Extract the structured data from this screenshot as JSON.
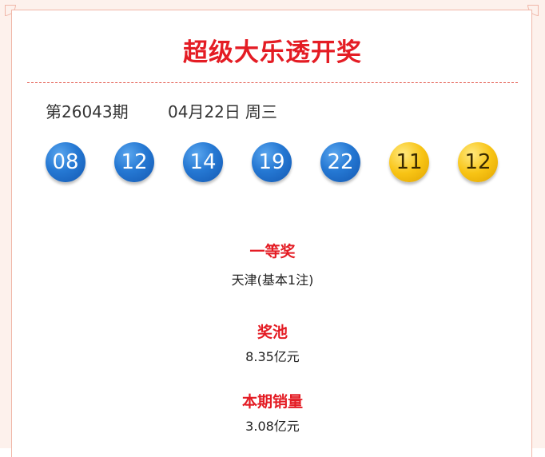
{
  "title": "超级大乐透开奖",
  "draw": {
    "issue": "第26043期",
    "date": "04月22日",
    "weekday": "周三"
  },
  "numbers": {
    "front": [
      "08",
      "12",
      "14",
      "19",
      "22"
    ],
    "back": [
      "11",
      "12"
    ]
  },
  "prizes": {
    "first_prize_label": "一等奖",
    "first_prize_value": "天津(基本1注)",
    "pool_label": "奖池",
    "pool_value": "8.35亿元",
    "sales_label": "本期销量",
    "sales_value": "3.08亿元"
  },
  "colors": {
    "accent_red": "#e41c24",
    "front_ball_blue": "#2578d3",
    "back_ball_yellow": "#f8c415"
  }
}
